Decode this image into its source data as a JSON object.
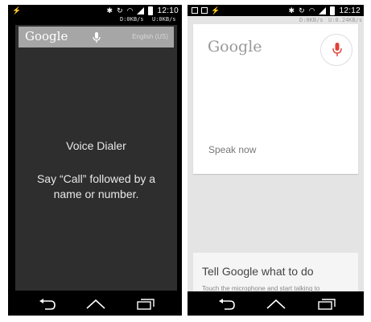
{
  "left_phone": {
    "status": {
      "clock": "12:10",
      "net_down": "D:0KB/s",
      "net_up": "U:0KB/s",
      "left_icons": [
        "flash-icon"
      ],
      "right_icons": [
        "bluetooth-icon",
        "rotate-icon",
        "wifi-icon",
        "signal-icon",
        "battery-icon"
      ]
    },
    "search_bar": {
      "logo": "Google",
      "language": "English (US)"
    },
    "voice_dialer": {
      "title": "Voice Dialer",
      "instructions": "Say “Call” followed by a name or number."
    },
    "nav": [
      "back-icon",
      "home-icon",
      "recent-apps-icon"
    ]
  },
  "right_phone": {
    "status": {
      "clock": "12:12",
      "net_down": "D:0KB/s",
      "net_up": "U:0.24KB/s",
      "left_icons": [
        "gmail-icon",
        "image-icon",
        "flash-icon"
      ],
      "right_icons": [
        "bluetooth-icon",
        "rotate-icon",
        "wifi-icon",
        "signal-icon",
        "battery-icon"
      ]
    },
    "google_card": {
      "logo": "Google",
      "speak_prompt": "Speak now"
    },
    "tell_card": {
      "title": "Tell Google what to do",
      "hint": "Touch the microphone and start talking to"
    },
    "nav": [
      "back-icon",
      "home-icon",
      "recent-apps-icon"
    ]
  },
  "colors": {
    "mic_active": "#e0413a",
    "dialer_bg": "#2e2e2e",
    "search_bar_bg": "#a6a6a6",
    "google_now_bg": "#e4e4e4"
  }
}
